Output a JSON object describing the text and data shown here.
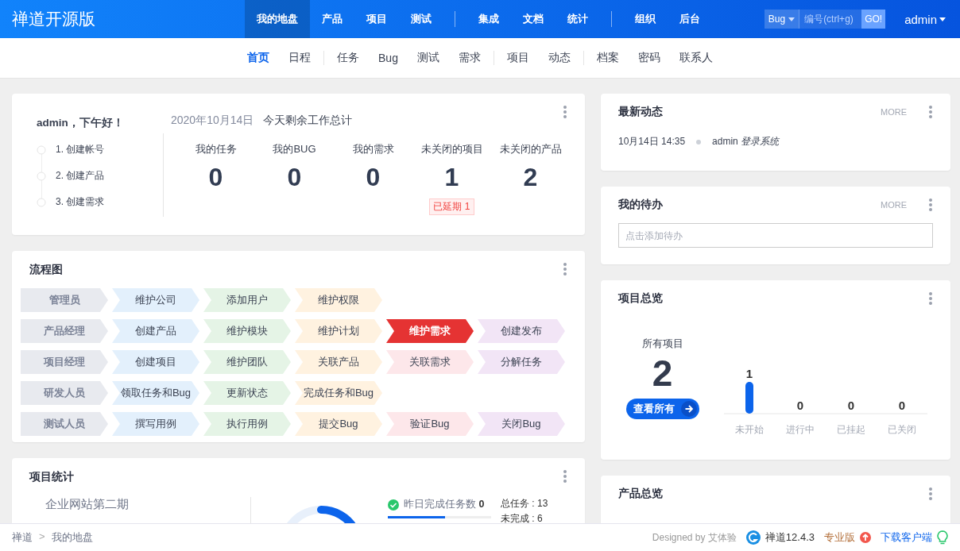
{
  "header": {
    "title": "禅道开源版",
    "nav_groups": [
      [
        {
          "label": "我的地盘",
          "selected": true
        },
        {
          "label": "产品",
          "selected": false
        },
        {
          "label": "项目",
          "selected": false
        },
        {
          "label": "测试",
          "selected": false
        }
      ],
      [
        {
          "label": "集成",
          "selected": false
        },
        {
          "label": "文档",
          "selected": false
        },
        {
          "label": "统计",
          "selected": false
        }
      ],
      [
        {
          "label": "组织",
          "selected": false
        },
        {
          "label": "后台",
          "selected": false
        }
      ]
    ],
    "search": {
      "type": "Bug",
      "placeholder": "编号(ctrl+g)",
      "button": "GO!"
    },
    "user": "admin"
  },
  "subnav_groups": [
    [
      {
        "label": "首页",
        "selected": true
      },
      {
        "label": "日程",
        "selected": false
      }
    ],
    [
      {
        "label": "任务",
        "selected": false
      },
      {
        "label": "Bug",
        "selected": false
      },
      {
        "label": "测试",
        "selected": false
      },
      {
        "label": "需求",
        "selected": false
      }
    ],
    [
      {
        "label": "项目",
        "selected": false
      },
      {
        "label": "动态",
        "selected": false
      }
    ],
    [
      {
        "label": "档案",
        "selected": false
      },
      {
        "label": "密码",
        "selected": false
      },
      {
        "label": "联系人",
        "selected": false
      }
    ]
  ],
  "welcome": {
    "greeting": "admin，下午好！",
    "steps": [
      {
        "label": "1. 创建帐号",
        "done": false
      },
      {
        "label": "2. 创建产品",
        "done": false
      },
      {
        "label": "3. 创建需求",
        "done": false
      }
    ],
    "date": "2020年10月14日",
    "summary_title": "今天剩余工作总计",
    "stats": [
      {
        "label": "我的任务",
        "value": "0"
      },
      {
        "label": "我的BUG",
        "value": "0"
      },
      {
        "label": "我的需求",
        "value": "0"
      },
      {
        "label": "未关闭的项目",
        "value": "1",
        "badge": "已延期 1"
      },
      {
        "label": "未关闭的产品",
        "value": "2"
      }
    ]
  },
  "flowchart": {
    "title": "流程图",
    "rows": [
      {
        "role": "管理员",
        "steps": [
          {
            "label": "维护公司",
            "color": "#e3f0fc",
            "highlighted": false
          },
          {
            "label": "添加用户",
            "color": "#e5f4e6",
            "highlighted": false
          },
          {
            "label": "维护权限",
            "color": "#fff2e0",
            "highlighted": false
          }
        ]
      },
      {
        "role": "产品经理",
        "steps": [
          {
            "label": "创建产品",
            "color": "#e3f0fc",
            "highlighted": false
          },
          {
            "label": "维护模块",
            "color": "#e5f4e6",
            "highlighted": false
          },
          {
            "label": "维护计划",
            "color": "#fff2e0",
            "highlighted": false
          },
          {
            "label": "维护需求",
            "color": "#e53333",
            "highlighted": true
          },
          {
            "label": "创建发布",
            "color": "#f2e5f6",
            "highlighted": false
          }
        ]
      },
      {
        "role": "项目经理",
        "steps": [
          {
            "label": "创建项目",
            "color": "#e3f0fc",
            "highlighted": false
          },
          {
            "label": "维护团队",
            "color": "#e5f4e6",
            "highlighted": false
          },
          {
            "label": "关联产品",
            "color": "#fff2e0",
            "highlighted": false
          },
          {
            "label": "关联需求",
            "color": "#fde7ea",
            "highlighted": false
          },
          {
            "label": "分解任务",
            "color": "#f2e5f6",
            "highlighted": false
          }
        ]
      },
      {
        "role": "研发人员",
        "steps": [
          {
            "label": "领取任务和Bug",
            "color": "#e3f0fc",
            "highlighted": false
          },
          {
            "label": "更新状态",
            "color": "#e5f4e6",
            "highlighted": false
          },
          {
            "label": "完成任务和Bug",
            "color": "#fff2e0",
            "highlighted": false
          }
        ]
      },
      {
        "role": "测试人员",
        "steps": [
          {
            "label": "撰写用例",
            "color": "#e3f0fc",
            "highlighted": false
          },
          {
            "label": "执行用例",
            "color": "#e5f4e6",
            "highlighted": false
          },
          {
            "label": "提交Bug",
            "color": "#fff2e0",
            "highlighted": false
          },
          {
            "label": "验证Bug",
            "color": "#fde7ea",
            "highlighted": false
          },
          {
            "label": "关闭Bug",
            "color": "#f2e5f6",
            "highlighted": false
          }
        ]
      }
    ]
  },
  "project_stats": {
    "title": "项目统计",
    "projects": [
      "企业网站第二期"
    ],
    "yesterday_label": "昨日完成任务数",
    "yesterday_value": "0",
    "level": 0.55,
    "totals": [
      "总任务 : 13",
      "未完成 : 6"
    ]
  },
  "dynamics": {
    "title": "最新动态",
    "more": "MORE",
    "entries": [
      {
        "time": "10月14日 14:35",
        "actor": "admin",
        "action": "登录系统"
      }
    ]
  },
  "todo": {
    "title": "我的待办",
    "more": "MORE",
    "placeholder": "点击添加待办"
  },
  "project_overview": {
    "title": "项目总览",
    "total_label": "所有项目",
    "total": "2",
    "button": "查看所有",
    "chart_data": {
      "type": "bar",
      "categories": [
        "未开始",
        "进行中",
        "已挂起",
        "已关闭"
      ],
      "values": [
        1,
        0,
        0,
        0
      ],
      "data_labels": true
    }
  },
  "product_overview": {
    "title": "产品总览"
  },
  "footer": {
    "breadcrumb": [
      "禅道",
      "我的地盘"
    ],
    "separator": ">",
    "designed_by": "Designed by",
    "designer": "艾体验",
    "version": "禅道12.4.3",
    "pro": "专业版",
    "download": "下载客户端"
  }
}
